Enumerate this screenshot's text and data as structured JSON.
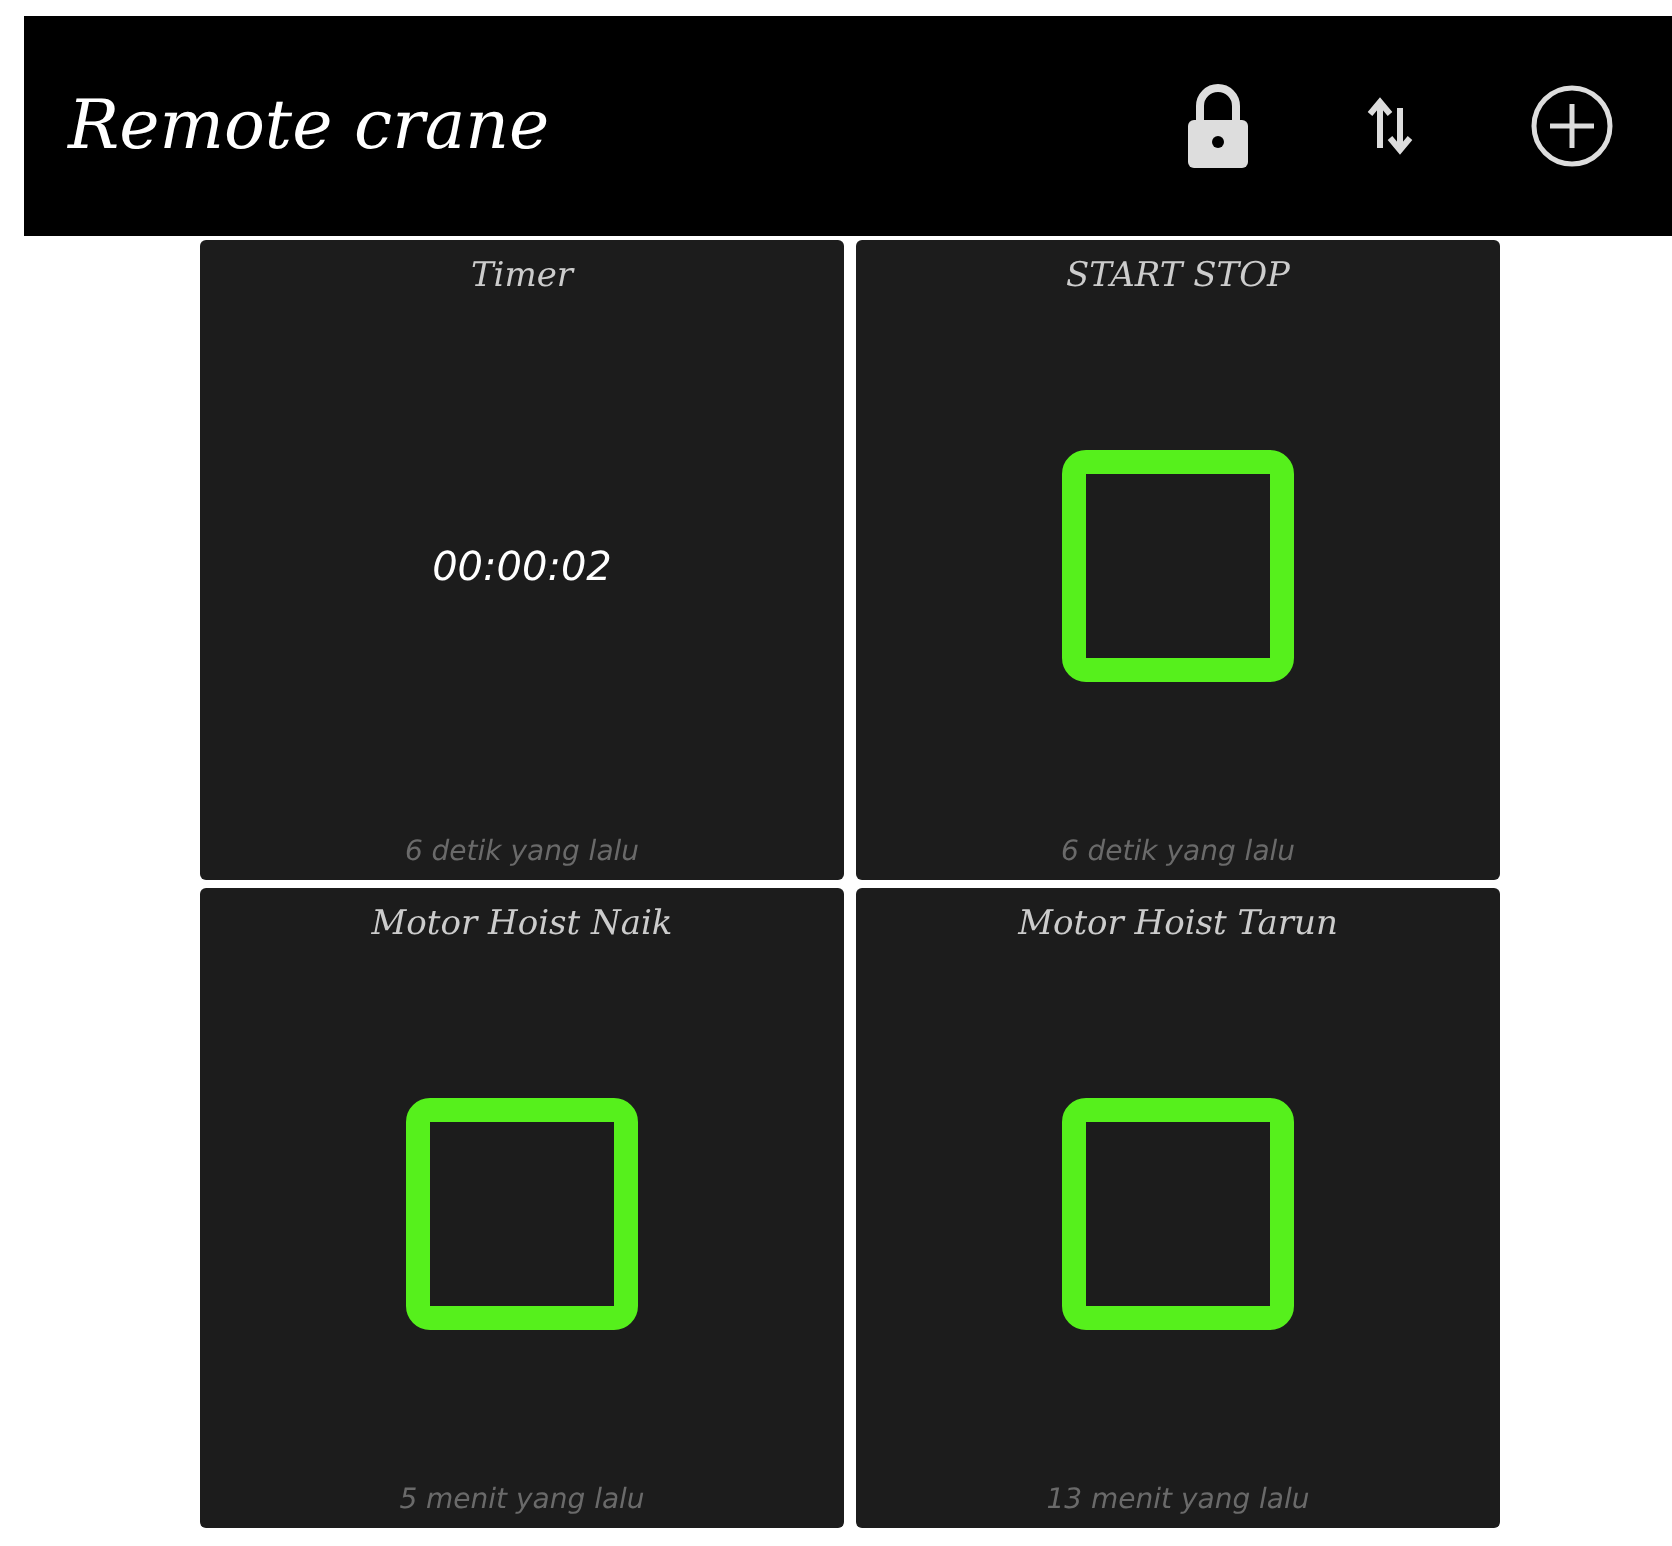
{
  "app_bar": {
    "title": "Remote crane"
  },
  "tiles": [
    {
      "kind": "timer",
      "title": "Timer",
      "value": "00:00:02",
      "updated": "6 detik yang lalu"
    },
    {
      "kind": "button",
      "title": "START STOP",
      "updated": "6 detik yang lalu"
    },
    {
      "kind": "button",
      "title": "Motor Hoist Naik",
      "updated": "5 menit yang lalu"
    },
    {
      "kind": "button",
      "title": "Motor Hoist Tarun",
      "updated": "13 menit yang lalu"
    }
  ]
}
